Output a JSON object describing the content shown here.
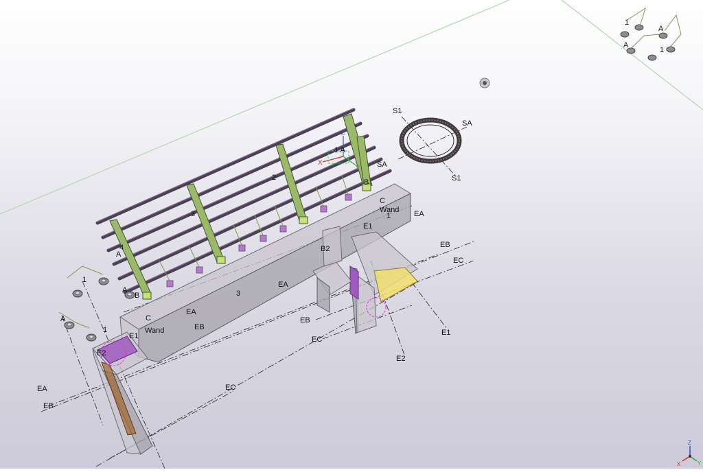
{
  "viewport": {
    "background_top": "#ffffff",
    "background_bottom": "#cdcbd9",
    "accent_colors": {
      "steel_column": "#9cb86a",
      "steel_beam": "#4b3f55",
      "embed_plate": "#b07cc7",
      "concrete": "#c9c6cf",
      "highlight_yellow": "#f2df70",
      "selection_magenta": "#d63bd6"
    }
  },
  "labels": {
    "s1_top": "S1",
    "sa_right": "SA",
    "s1_bottom": "S1",
    "sa_bottom": "SA",
    "num2": "2",
    "num3_upper": "3",
    "num3_lower": "3",
    "num4": "4",
    "a_left": "A",
    "a_mid": "A",
    "b_left": "B",
    "b_right": "B",
    "one_a_top": "1 A",
    "c_right": "C",
    "wand_right": "Wand",
    "one_right": "1",
    "ea_right": "EA",
    "e1_mid": "E1",
    "b2": "B2",
    "eb_right": "EB",
    "ec_right": "EC",
    "ea_center": "EA",
    "eb_mid": "EB",
    "ec_mid": "EC",
    "e1_far": "E1",
    "e2_bottom": "E2",
    "c_left": "C",
    "wand_left": "Wand",
    "ea_left_mid": "EA",
    "eb_left_mid": "EB",
    "e1_left": "E1",
    "e2_left": "E2",
    "ea_far_left": "EA",
    "eb_far_left": "EB",
    "ec_lower": "EC",
    "one_left_group": "1",
    "a_left_group": "A",
    "one_left_group2": "1",
    "inset_one_a": "1",
    "inset_a_right": "A",
    "inset_a_left": "A",
    "inset_one_b": "1",
    "triad_z": "Z",
    "triad_y": "Y",
    "triad_x": "X",
    "gizmo_z": "Z",
    "gizmo_x": "X",
    "gizmo_y": "Y"
  },
  "icons": {
    "orientation_triad": "xyz-axis-triad-icon",
    "camera_target": "view-center-target-icon",
    "local_gizmo": "local-axis-gizmo-icon"
  }
}
